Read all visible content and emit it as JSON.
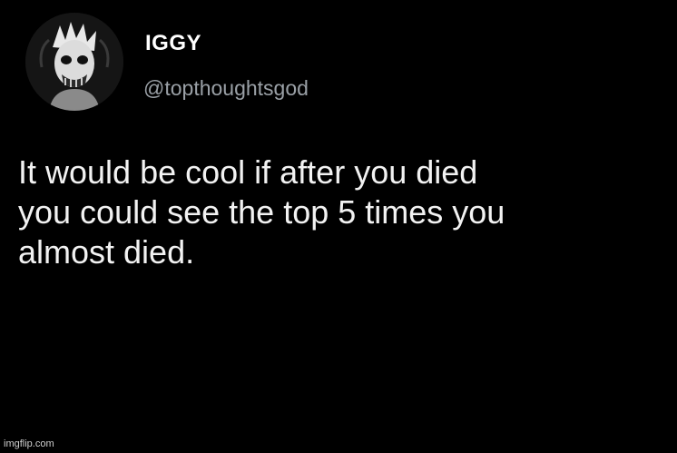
{
  "tweet": {
    "display_name": "IGGY",
    "handle": "@topthoughtsgod",
    "text_lines": [
      "It would be cool if after you died",
      "you could see the top 5 times you",
      "almost died."
    ]
  },
  "watermark": "imgflip.com",
  "colors": {
    "background": "#000000",
    "name": "#ffffff",
    "handle": "#9aa0a6",
    "text": "#f2f2f2"
  },
  "icons": {
    "avatar": "avatar-icon"
  }
}
